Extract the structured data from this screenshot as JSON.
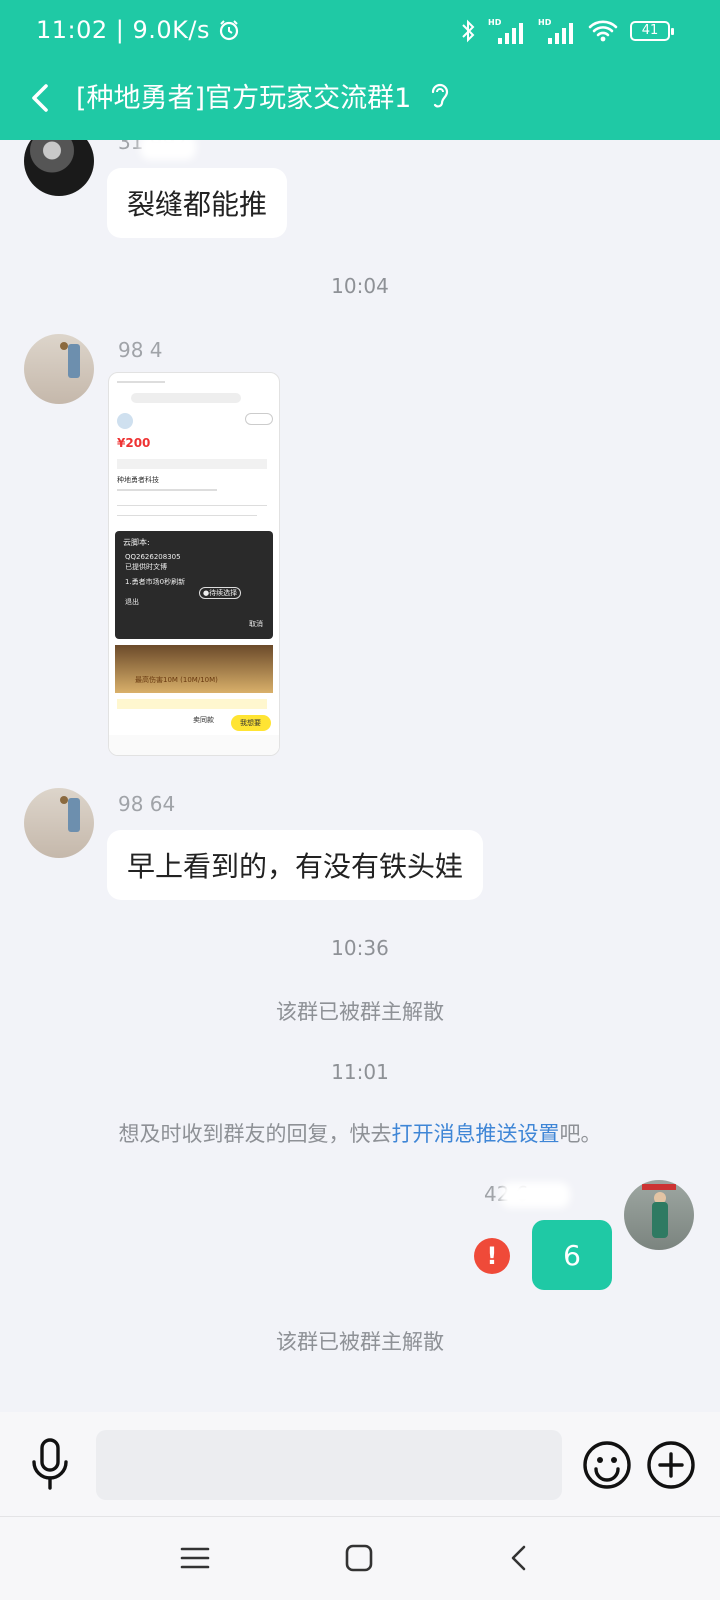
{
  "status_bar": {
    "time": "11:02",
    "speed": "9.0K/s",
    "battery": "41"
  },
  "header": {
    "title": "[种地勇者]官方玩家交流群1"
  },
  "messages": {
    "m1": {
      "sender": "31  997",
      "text": "裂缝都能推"
    },
    "time1": "10:04",
    "m2": {
      "sender": "98  4"
    },
    "m3": {
      "sender": "98  64",
      "text": "早上看到的，有没有铁头娃"
    },
    "time2": "10:36",
    "sys1": "该群已被群主解散",
    "time3": "11:01",
    "notice": {
      "prefix": "想及时收到群友的回复，快去",
      "link": "打开消息推送设置",
      "suffix": "吧。"
    },
    "m4": {
      "sender": "42  6",
      "text": "6",
      "error_mark": "!"
    },
    "sys2": "该群已被群主解散"
  },
  "screenshot_preview": {
    "price": "¥200",
    "title_line1": "种地勇者科技",
    "popup_title": "云脚本:",
    "popup_line1": "QQ2626208305",
    "popup_line2": "已提供时文博",
    "popup_line3": "1.勇者市场0秒刷新",
    "popup_exit": "退出",
    "popup_cancel": "取消",
    "popup_btn": "●待续选择",
    "game_banner": "最高伤害10M (10M/10M)",
    "btn_ask": "卖同款",
    "btn_want": "我想要"
  },
  "colors": {
    "accent": "#1fc9a5",
    "link": "#3f86d6",
    "error": "#ef4a39"
  }
}
